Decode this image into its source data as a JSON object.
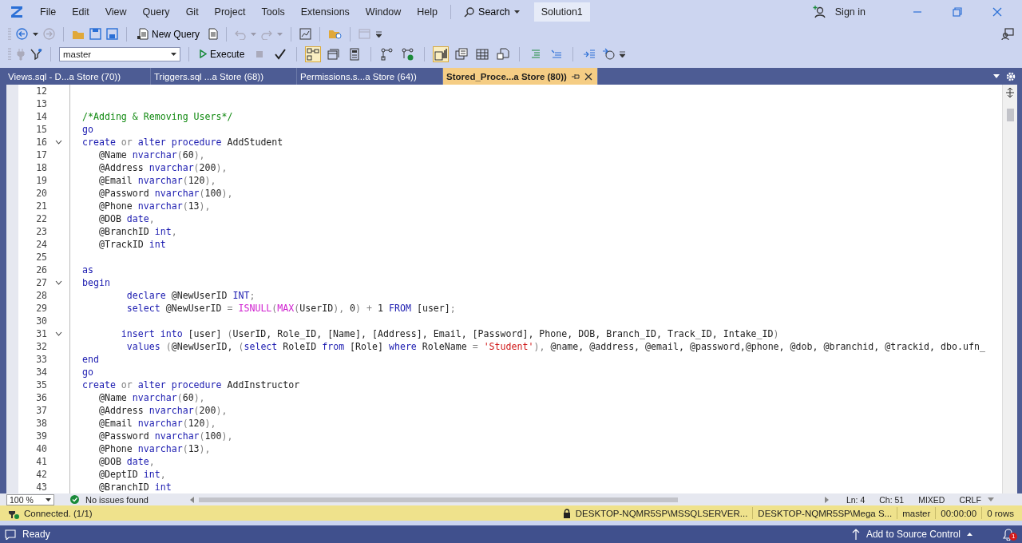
{
  "window": {
    "title": "Solution1"
  },
  "menu": [
    "File",
    "Edit",
    "View",
    "Query",
    "Git",
    "Project",
    "Tools",
    "Extensions",
    "Window",
    "Help"
  ],
  "search": {
    "label": "Search"
  },
  "account": {
    "label": "Sign in"
  },
  "toolbar": {
    "new_query": "New Query",
    "database": "master",
    "execute": "Execute",
    "toggles": [
      {
        "on": false
      },
      {
        "on": false
      },
      {
        "on": true
      },
      {
        "on": false
      },
      {
        "on": false
      },
      {
        "on": false
      },
      {
        "on": false
      },
      {
        "on": true
      },
      {
        "on": false
      },
      {
        "on": false
      },
      {
        "on": false
      },
      {
        "on": false
      },
      {
        "on": false
      },
      {
        "on": false
      }
    ]
  },
  "tabs": [
    {
      "label": "Views.sql - D...a Store (70))",
      "selected": false
    },
    {
      "label": "Triggers.sql ...a Store (68))",
      "selected": false
    },
    {
      "label": "Permissions.s...a Store (64))",
      "selected": false
    },
    {
      "label": "Stored_Proce...a Store (80))",
      "selected": true
    }
  ],
  "editor": {
    "lines": [
      {
        "n": "12",
        "fold": false
      },
      {
        "n": "13",
        "fold": false
      },
      {
        "n": "14",
        "fold": false,
        "tokens": [
          {
            "kind": "cm",
            "t": "/*Adding & Removing Users*/"
          }
        ]
      },
      {
        "n": "15",
        "fold": false,
        "tokens": [
          {
            "kind": "kw",
            "t": "go"
          }
        ]
      },
      {
        "n": "16",
        "fold": true,
        "tokens": [
          {
            "kind": "kw",
            "t": "create"
          },
          {
            "kind": "op",
            "t": " or"
          },
          {
            "kind": "kw",
            "t": " alter procedure"
          },
          {
            "kind": "tx",
            "t": " AddStudent"
          }
        ]
      },
      {
        "n": "17",
        "fold": false,
        "tokens": [
          {
            "kind": "tx",
            "t": "   @Name "
          },
          {
            "kind": "kw",
            "t": "nvarchar"
          },
          {
            "kind": "op",
            "t": "("
          },
          {
            "kind": "tx",
            "t": "60"
          },
          {
            "kind": "op",
            "t": "),"
          }
        ]
      },
      {
        "n": "18",
        "fold": false,
        "tokens": [
          {
            "kind": "tx",
            "t": "   @Address "
          },
          {
            "kind": "kw",
            "t": "nvarchar"
          },
          {
            "kind": "op",
            "t": "("
          },
          {
            "kind": "tx",
            "t": "200"
          },
          {
            "kind": "op",
            "t": "),"
          }
        ]
      },
      {
        "n": "19",
        "fold": false,
        "tokens": [
          {
            "kind": "tx",
            "t": "   @Email "
          },
          {
            "kind": "kw",
            "t": "nvarchar"
          },
          {
            "kind": "op",
            "t": "("
          },
          {
            "kind": "tx",
            "t": "120"
          },
          {
            "kind": "op",
            "t": "),"
          }
        ]
      },
      {
        "n": "20",
        "fold": false,
        "tokens": [
          {
            "kind": "tx",
            "t": "   @Password "
          },
          {
            "kind": "kw",
            "t": "nvarchar"
          },
          {
            "kind": "op",
            "t": "("
          },
          {
            "kind": "tx",
            "t": "100"
          },
          {
            "kind": "op",
            "t": "),"
          }
        ]
      },
      {
        "n": "21",
        "fold": false,
        "tokens": [
          {
            "kind": "tx",
            "t": "   @Phone "
          },
          {
            "kind": "kw",
            "t": "nvarchar"
          },
          {
            "kind": "op",
            "t": "("
          },
          {
            "kind": "tx",
            "t": "13"
          },
          {
            "kind": "op",
            "t": "),"
          }
        ]
      },
      {
        "n": "22",
        "fold": false,
        "tokens": [
          {
            "kind": "tx",
            "t": "   @DOB "
          },
          {
            "kind": "kw",
            "t": "date"
          },
          {
            "kind": "op",
            "t": ","
          }
        ]
      },
      {
        "n": "23",
        "fold": false,
        "tokens": [
          {
            "kind": "tx",
            "t": "   @BranchID "
          },
          {
            "kind": "kw",
            "t": "int"
          },
          {
            "kind": "op",
            "t": ","
          }
        ]
      },
      {
        "n": "24",
        "fold": false,
        "tokens": [
          {
            "kind": "tx",
            "t": "   @TrackID "
          },
          {
            "kind": "kw",
            "t": "int"
          }
        ]
      },
      {
        "n": "25",
        "fold": false
      },
      {
        "n": "26",
        "fold": false,
        "tokens": [
          {
            "kind": "kw",
            "t": "as"
          }
        ]
      },
      {
        "n": "27",
        "fold": true,
        "tokens": [
          {
            "kind": "kw",
            "t": "begin"
          }
        ]
      },
      {
        "n": "28",
        "fold": false,
        "tokens": [
          {
            "kind": "kw",
            "t": "        declare"
          },
          {
            "kind": "tx",
            "t": " @NewUserID "
          },
          {
            "kind": "kw",
            "t": "INT"
          },
          {
            "kind": "op",
            "t": ";"
          }
        ]
      },
      {
        "n": "29",
        "fold": false,
        "tokens": [
          {
            "kind": "kw",
            "t": "        select"
          },
          {
            "kind": "tx",
            "t": " @NewUserID "
          },
          {
            "kind": "op",
            "t": "="
          },
          {
            "kind": "fn",
            "t": " ISNULL"
          },
          {
            "kind": "op",
            "t": "("
          },
          {
            "kind": "fn",
            "t": "MAX"
          },
          {
            "kind": "op",
            "t": "("
          },
          {
            "kind": "tx",
            "t": "UserID"
          },
          {
            "kind": "op",
            "t": "),"
          },
          {
            "kind": "tx",
            "t": " 0"
          },
          {
            "kind": "op",
            "t": ")"
          },
          {
            "kind": "op",
            "t": " +"
          },
          {
            "kind": "tx",
            "t": " 1 "
          },
          {
            "kind": "kw",
            "t": "FROM"
          },
          {
            "kind": "tx",
            "t": " [user]"
          },
          {
            "kind": "op",
            "t": ";"
          }
        ]
      },
      {
        "n": "30",
        "fold": false
      },
      {
        "n": "31",
        "fold": true,
        "tokens": [
          {
            "kind": "kw",
            "t": "       insert into"
          },
          {
            "kind": "tx",
            "t": " [user] "
          },
          {
            "kind": "op",
            "t": "("
          },
          {
            "kind": "tx",
            "t": "UserID, Role_ID, [Name], [Address], Email, [Password], Phone, DOB, Branch_ID, Track_ID, Intake_ID"
          },
          {
            "kind": "op",
            "t": ")"
          }
        ]
      },
      {
        "n": "32",
        "fold": false,
        "tokens": [
          {
            "kind": "kw",
            "t": "        values"
          },
          {
            "kind": "op",
            "t": " ("
          },
          {
            "kind": "tx",
            "t": "@NewUserID, "
          },
          {
            "kind": "op",
            "t": "("
          },
          {
            "kind": "kw",
            "t": "select"
          },
          {
            "kind": "tx",
            "t": " RoleID "
          },
          {
            "kind": "kw",
            "t": "from"
          },
          {
            "kind": "tx",
            "t": " [Role] "
          },
          {
            "kind": "kw",
            "t": "where"
          },
          {
            "kind": "tx",
            "t": " RoleName "
          },
          {
            "kind": "op",
            "t": "="
          },
          {
            "kind": "str",
            "t": " 'Student'"
          },
          {
            "kind": "op",
            "t": "),"
          },
          {
            "kind": "tx",
            "t": " @name, @address, @email, @password,@phone, @dob, @branchid, @trackid, dbo.ufn_"
          }
        ]
      },
      {
        "n": "33",
        "fold": false,
        "tokens": [
          {
            "kind": "kw",
            "t": "end"
          }
        ]
      },
      {
        "n": "34",
        "fold": false,
        "tokens": [
          {
            "kind": "kw",
            "t": "go"
          }
        ]
      },
      {
        "n": "35",
        "fold": false,
        "tokens": [
          {
            "kind": "kw",
            "t": "create"
          },
          {
            "kind": "op",
            "t": " or"
          },
          {
            "kind": "kw",
            "t": " alter procedure"
          },
          {
            "kind": "tx",
            "t": " AddInstructor"
          }
        ]
      },
      {
        "n": "36",
        "fold": false,
        "tokens": [
          {
            "kind": "tx",
            "t": "   @Name "
          },
          {
            "kind": "kw",
            "t": "nvarchar"
          },
          {
            "kind": "op",
            "t": "("
          },
          {
            "kind": "tx",
            "t": "60"
          },
          {
            "kind": "op",
            "t": "),"
          }
        ]
      },
      {
        "n": "37",
        "fold": false,
        "tokens": [
          {
            "kind": "tx",
            "t": "   @Address "
          },
          {
            "kind": "kw",
            "t": "nvarchar"
          },
          {
            "kind": "op",
            "t": "("
          },
          {
            "kind": "tx",
            "t": "200"
          },
          {
            "kind": "op",
            "t": "),"
          }
        ]
      },
      {
        "n": "38",
        "fold": false,
        "tokens": [
          {
            "kind": "tx",
            "t": "   @Email "
          },
          {
            "kind": "kw",
            "t": "nvarchar"
          },
          {
            "kind": "op",
            "t": "("
          },
          {
            "kind": "tx",
            "t": "120"
          },
          {
            "kind": "op",
            "t": "),"
          }
        ]
      },
      {
        "n": "39",
        "fold": false,
        "tokens": [
          {
            "kind": "tx",
            "t": "   @Password "
          },
          {
            "kind": "kw",
            "t": "nvarchar"
          },
          {
            "kind": "op",
            "t": "("
          },
          {
            "kind": "tx",
            "t": "100"
          },
          {
            "kind": "op",
            "t": "),"
          }
        ]
      },
      {
        "n": "40",
        "fold": false,
        "tokens": [
          {
            "kind": "tx",
            "t": "   @Phone "
          },
          {
            "kind": "kw",
            "t": "nvarchar"
          },
          {
            "kind": "op",
            "t": "("
          },
          {
            "kind": "tx",
            "t": "13"
          },
          {
            "kind": "op",
            "t": "),"
          }
        ]
      },
      {
        "n": "41",
        "fold": false,
        "tokens": [
          {
            "kind": "tx",
            "t": "   @DOB "
          },
          {
            "kind": "kw",
            "t": "date"
          },
          {
            "kind": "op",
            "t": ","
          }
        ]
      },
      {
        "n": "42",
        "fold": false,
        "tokens": [
          {
            "kind": "tx",
            "t": "   @DeptID "
          },
          {
            "kind": "kw",
            "t": "int"
          },
          {
            "kind": "op",
            "t": ","
          }
        ]
      },
      {
        "n": "43",
        "fold": false,
        "tokens": [
          {
            "kind": "tx",
            "t": "   @BranchID "
          },
          {
            "kind": "kw",
            "t": "int"
          }
        ]
      }
    ]
  },
  "editor_status": {
    "zoom": "100 %",
    "issues": "No issues found",
    "line": "Ln: 4",
    "column": "Ch: 51",
    "encoding": "MIXED",
    "line_ending": "CRLF"
  },
  "connection_bar": {
    "status": "Connected. (1/1)",
    "server": "DESKTOP-NQMR5SP\\MSSQLSERVER...",
    "user": "DESKTOP-NQMR5SP\\Mega S...",
    "database": "master",
    "elapsed": "00:00:00",
    "rows": "0 rows"
  },
  "status_bar": {
    "status": "Ready",
    "source_control": "Add to Source Control",
    "notifications": "1"
  }
}
